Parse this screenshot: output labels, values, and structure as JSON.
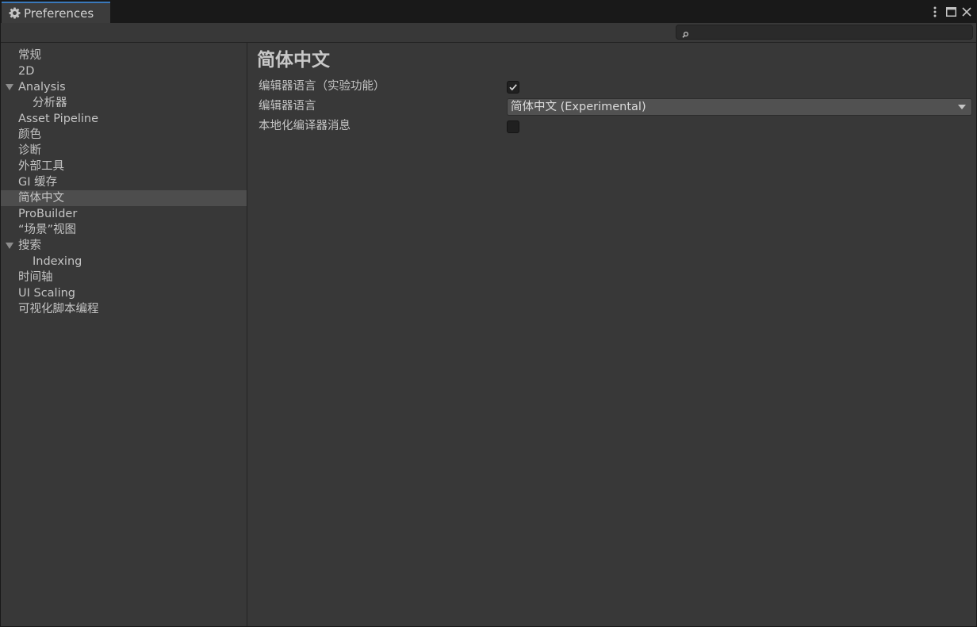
{
  "window": {
    "tab_title": "Preferences",
    "tab_icon": "gear-icon",
    "controls": [
      "more-options-icon",
      "maximize-icon",
      "close-icon"
    ]
  },
  "search": {
    "value": "",
    "placeholder": ""
  },
  "sidebar": {
    "selected": "简体中文",
    "items": [
      {
        "label": "常规",
        "level": 0,
        "foldout": false,
        "selected": false
      },
      {
        "label": "2D",
        "level": 0,
        "foldout": false,
        "selected": false
      },
      {
        "label": "Analysis",
        "level": 0,
        "foldout": true,
        "selected": false
      },
      {
        "label": "分析器",
        "level": 1,
        "foldout": false,
        "selected": false
      },
      {
        "label": "Asset Pipeline",
        "level": 0,
        "foldout": false,
        "selected": false
      },
      {
        "label": "颜色",
        "level": 0,
        "foldout": false,
        "selected": false
      },
      {
        "label": "诊断",
        "level": 0,
        "foldout": false,
        "selected": false
      },
      {
        "label": "外部工具",
        "level": 0,
        "foldout": false,
        "selected": false
      },
      {
        "label": "GI 缓存",
        "level": 0,
        "foldout": false,
        "selected": false
      },
      {
        "label": "简体中文",
        "level": 0,
        "foldout": false,
        "selected": true
      },
      {
        "label": "ProBuilder",
        "level": 0,
        "foldout": false,
        "selected": false
      },
      {
        "label": "“场景”视图",
        "level": 0,
        "foldout": false,
        "selected": false
      },
      {
        "label": "搜索",
        "level": 0,
        "foldout": true,
        "selected": false
      },
      {
        "label": "Indexing",
        "level": 1,
        "foldout": false,
        "selected": false
      },
      {
        "label": "时间轴",
        "level": 0,
        "foldout": false,
        "selected": false
      },
      {
        "label": "UI Scaling",
        "level": 0,
        "foldout": false,
        "selected": false
      },
      {
        "label": "可视化脚本编程",
        "level": 0,
        "foldout": false,
        "selected": false
      }
    ]
  },
  "content": {
    "title": "简体中文",
    "fields": {
      "editor_language_experimental": {
        "label": "编辑器语言（实验功能）",
        "checked": true
      },
      "editor_language": {
        "label": "编辑器语言",
        "value": "简体中文 (Experimental)"
      },
      "localize_compiler_messages": {
        "label": "本地化编译器消息",
        "checked": false
      }
    }
  },
  "colors": {
    "background": "#383838",
    "titlebar": "#191919",
    "selected_row": "#4d4d4d",
    "tab_accent": "#3a79bb",
    "text": "#c4c4c4"
  }
}
